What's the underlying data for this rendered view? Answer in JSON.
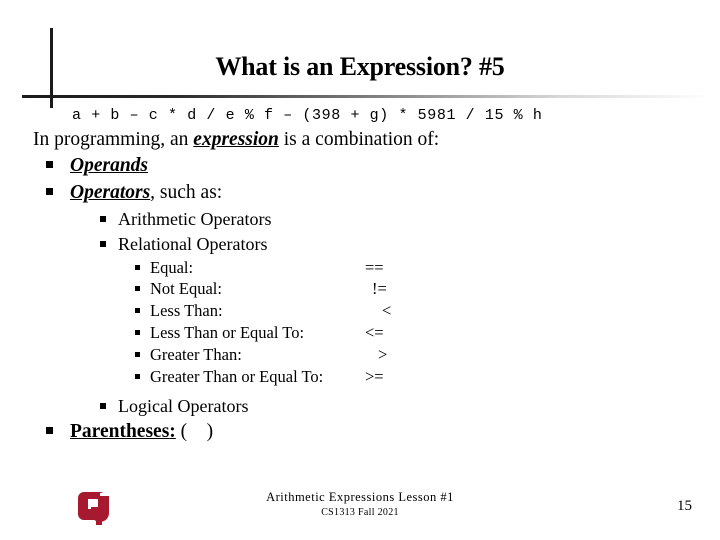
{
  "slide": {
    "title": "What is an Expression? #5",
    "code_line": "a + b – c * d / e % f – (398 + g) * 5981 / 15 % h",
    "intro": {
      "prefix": "In programming, an ",
      "term": "expression",
      "suffix": " is a combination of:"
    },
    "operands": {
      "term": "Operands"
    },
    "operators": {
      "term": "Operators",
      "suffix": ", such as:"
    },
    "operator_categories": [
      {
        "label": "Arithmetic Operators"
      },
      {
        "label": "Relational Operators"
      }
    ],
    "relational_operators": [
      {
        "label": "Equal:",
        "symbol": "=="
      },
      {
        "label": "Not Equal:",
        "symbol": "!="
      },
      {
        "label": "Less Than:",
        "symbol": "<"
      },
      {
        "label": "Less Than or Equal To:",
        "symbol": "<="
      },
      {
        "label": "Greater Than:",
        "symbol": ">"
      },
      {
        "label": "Greater Than or Equal To:",
        "symbol": ">="
      }
    ],
    "logical_operators": {
      "label": "Logical Operators"
    },
    "parentheses": {
      "term": "Parentheses",
      "colon": ":",
      "open": "(",
      "close": ")"
    }
  },
  "footer": {
    "line1": "Arithmetic Expressions Lesson #1",
    "line2": "CS1313 Fall 2021",
    "slide_number": "15"
  },
  "logo": {
    "name": "ou-logo",
    "text": "OU",
    "color": "#A6192E"
  }
}
